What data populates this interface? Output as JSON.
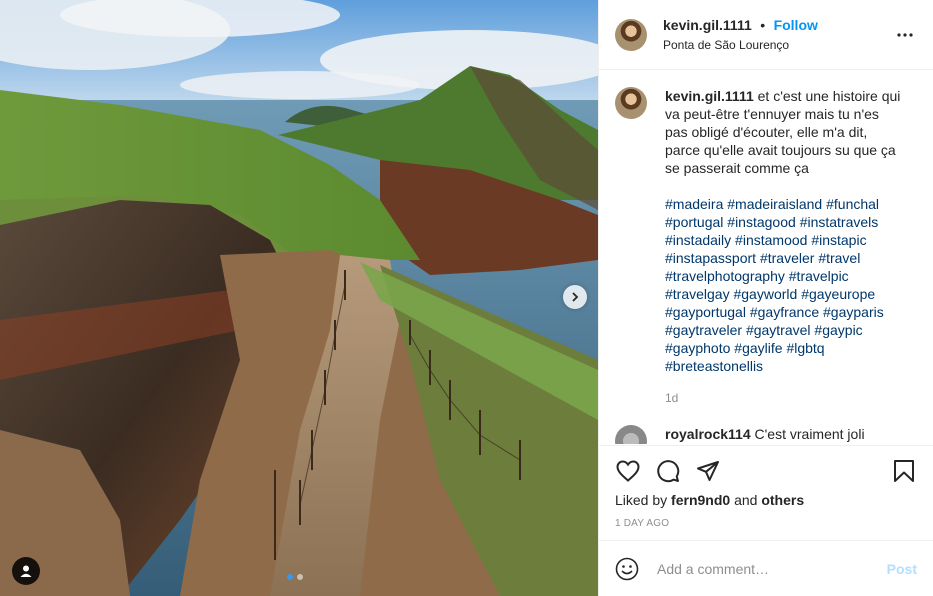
{
  "post": {
    "author": "kevin.gil.1111",
    "separator": "•",
    "follow_label": "Follow",
    "location": "Ponta de São Lourenço",
    "caption": "et c'est une histoire qui va peut-être t'ennuyer mais tu n'es pas obligé d'écouter, elle m'a dit, parce qu'elle avait toujours su que ça se passerait comme ça",
    "hashtags": [
      "#madeira",
      "#madeiraisland",
      "#funchal",
      "#portugal",
      "#instagood",
      "#instatravels",
      "#instadaily",
      "#instamood",
      "#instapic",
      "#instapassport",
      "#traveler",
      "#travel",
      "#travelphotography",
      "#travelpic",
      "#travelgay",
      "#gayworld",
      "#gayeurope",
      "#gayportugal",
      "#gayfrance",
      "#gayparis",
      "#gaytraveler",
      "#gaytravel",
      "#gaypic",
      "#gayphoto",
      "#gaylife",
      "#lgbtq",
      "#breteastonellis"
    ],
    "caption_age": "1d",
    "next_comment_user": "royalrock114",
    "next_comment_text": "C'est vraiment joli"
  },
  "likes": {
    "prefix": "Liked by",
    "user": "fern9nd0",
    "conj": "and",
    "others": "others"
  },
  "date": "1 DAY AGO",
  "comment_box": {
    "placeholder": "Add a comment…",
    "post_label": "Post"
  },
  "carousel": {
    "slides": 2,
    "active": 0
  },
  "icons": [
    "more-options-icon",
    "heart-icon",
    "comment-icon",
    "share-icon",
    "bookmark-icon",
    "emoji-icon",
    "chevron-right-icon",
    "user-tag-icon"
  ],
  "colors": {
    "accent": "#0095f6",
    "hashtag": "#00376b",
    "muted": "#8e8e8e"
  }
}
